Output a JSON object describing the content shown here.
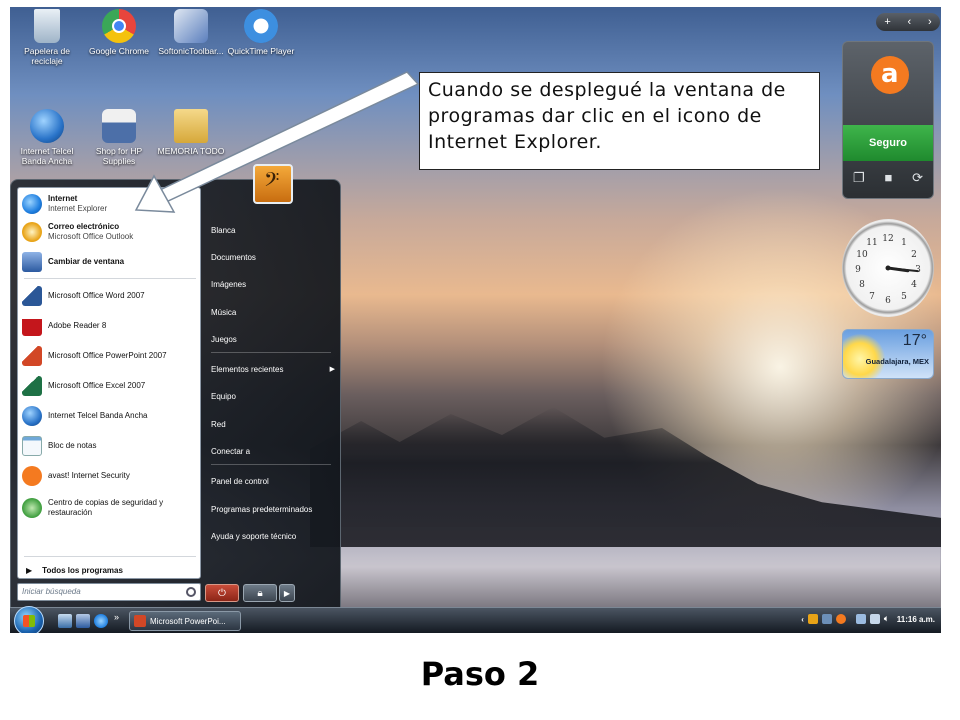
{
  "desktop_icons": [
    {
      "name": "recycle-bin-icon",
      "label": "Papelera de reciclaje",
      "color": "#c9d8e6"
    },
    {
      "name": "chrome-icon",
      "label": "Google Chrome",
      "color": "#e8453c"
    },
    {
      "name": "softonic-icon",
      "label": "SoftonicToolbar...",
      "color": "#5a7ebd"
    },
    {
      "name": "quicktime-icon",
      "label": "QuickTime Player",
      "color": "#3d8fe0"
    },
    {
      "name": "telcel-3g-icon",
      "label": "Internet Telcel Banda Ancha",
      "color": "#2a74c9"
    },
    {
      "name": "hp-supplies-icon",
      "label": "Shop for HP Supplies",
      "color": "#4c6fa8"
    },
    {
      "name": "folder-icon",
      "label": "MEMORIA TODO",
      "color": "#e4c068"
    }
  ],
  "sidebar": {
    "toolbar": {
      "add": "+",
      "prev": "‹",
      "next": "›"
    },
    "avast": {
      "status": "Seguro",
      "accent": "#f47a20",
      "status_color": "#2aa23a"
    },
    "clock": {
      "hour": 3,
      "minute": 16
    },
    "weather": {
      "temp": "17°",
      "city": "Guadalajara, MEX"
    }
  },
  "start_menu": {
    "pinned": [
      {
        "title": "Internet",
        "subtitle": "Internet Explorer",
        "icon": "internet-explorer-icon",
        "color": "#1f7fe0"
      },
      {
        "title": "Correo electrónico",
        "subtitle": "Microsoft Office Outlook",
        "icon": "outlook-icon",
        "color": "#e8a317"
      }
    ],
    "recent": [
      {
        "label": "Cambiar de ventana",
        "icon": "switch-windows-icon",
        "color": "#2c5aa0",
        "bold": true
      },
      {
        "label": "Microsoft Office Word 2007",
        "icon": "word-icon",
        "color": "#2b5797"
      },
      {
        "label": "Adobe Reader 8",
        "icon": "adobe-reader-icon",
        "color": "#c4161c"
      },
      {
        "label": "Microsoft Office PowerPoint 2007",
        "icon": "powerpoint-icon",
        "color": "#d24726"
      },
      {
        "label": "Microsoft Office Excel 2007",
        "icon": "excel-icon",
        "color": "#1e7145"
      },
      {
        "label": "Internet Telcel Banda Ancha",
        "icon": "telcel-3g-icon",
        "color": "#2a74c9"
      },
      {
        "label": "Bloc de notas",
        "icon": "notepad-icon",
        "color": "#6fa8d8"
      },
      {
        "label": "avast! Internet Security",
        "icon": "avast-icon",
        "color": "#f47a20"
      },
      {
        "label": "Centro de copias de seguridad y restauración",
        "icon": "backup-icon",
        "color": "#3b9c3b"
      }
    ],
    "all_programs": "Todos los programas",
    "search_placeholder": "Iniciar búsqueda",
    "right_links": [
      "Blanca",
      "Documentos",
      "Imágenes",
      "Música",
      "Juegos",
      "Elementos recientes",
      "Equipo",
      "Red",
      "Conectar a",
      "Panel de control",
      "Programas predeterminados",
      "Ayuda y soporte técnico"
    ]
  },
  "taskbar": {
    "task_label": "Microsoft PowerPoi...",
    "time": "11:16 a.m.",
    "overflow": "»"
  },
  "callout": {
    "text": "Cuando se desplegué la ventana de programas dar clic en el icono de Internet Explorer."
  },
  "step_title": "Paso 2"
}
